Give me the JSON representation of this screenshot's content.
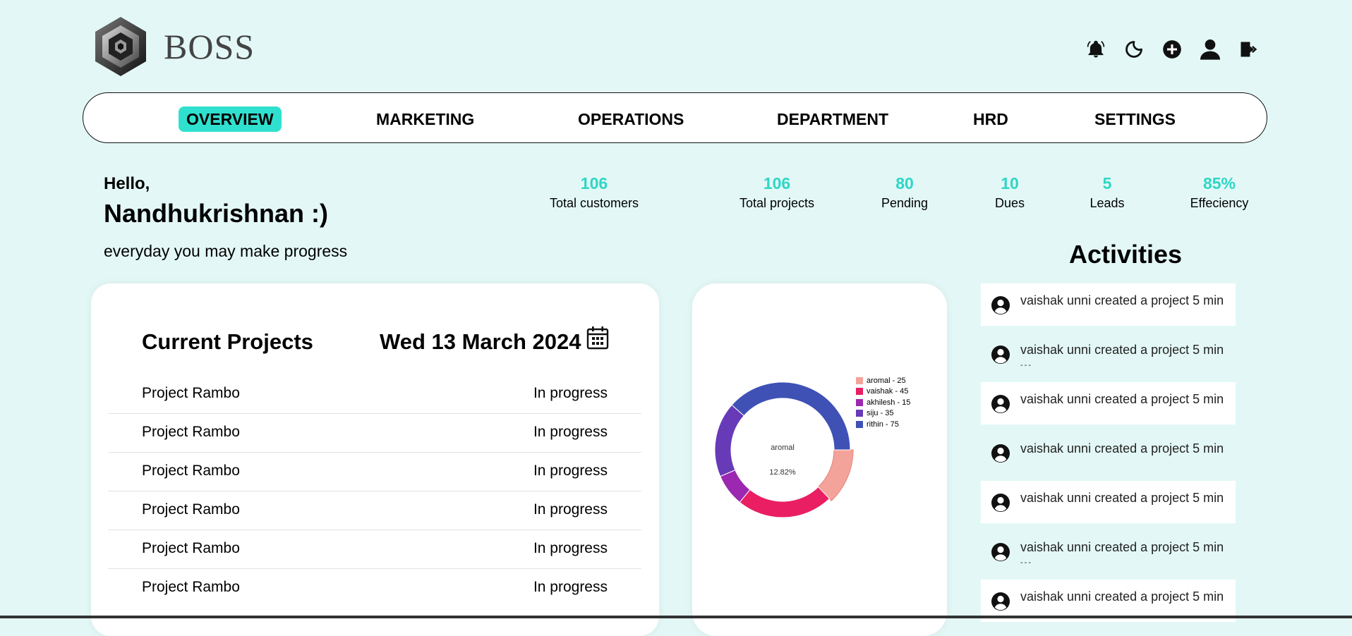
{
  "header": {
    "brand": "BOSS",
    "icons": [
      "bell-icon",
      "moon-icon",
      "plus-circle-icon",
      "user-icon",
      "logout-icon"
    ]
  },
  "nav": {
    "tabs": [
      {
        "label": "OVERVIEW",
        "active": true
      },
      {
        "label": "MARKETING",
        "active": false
      },
      {
        "label": "OPERATIONS",
        "active": false
      },
      {
        "label": "DEPARTMENT",
        "active": false
      },
      {
        "label": "HRD",
        "active": false
      },
      {
        "label": "SETTINGS",
        "active": false
      }
    ]
  },
  "greeting": {
    "hello": "Hello,",
    "name": "Nandhukrishnan :)",
    "tagline": "everyday you may make progress"
  },
  "stats": [
    {
      "value": "106",
      "label": "Total customers"
    },
    {
      "value": "106",
      "label": "Total projects"
    },
    {
      "value": "80",
      "label": "Pending"
    },
    {
      "value": "10",
      "label": "Dues"
    },
    {
      "value": "5",
      "label": "Leads"
    },
    {
      "value": "85%",
      "label": "Effeciency"
    }
  ],
  "projects": {
    "title": "Current Projects",
    "date": "Wed 13 March 2024",
    "rows": [
      {
        "name": "Project Rambo",
        "status": "In progress"
      },
      {
        "name": "Project Rambo",
        "status": "In progress"
      },
      {
        "name": "Project Rambo",
        "status": "In progress"
      },
      {
        "name": "Project Rambo",
        "status": "In progress"
      },
      {
        "name": "Project Rambo",
        "status": "In progress"
      },
      {
        "name": "Project Rambo",
        "status": "In progress"
      }
    ]
  },
  "chart_data": {
    "type": "pie",
    "variant": "donut",
    "legend_position": "top-right",
    "center_label": "aromal",
    "center_value": "12.82%",
    "labels": [
      "aromal - 25",
      "vaishak - 45",
      "akhilesh - 15",
      "siju - 35",
      "rithin - 75"
    ],
    "values": [
      25,
      45,
      15,
      35,
      75
    ],
    "colors": [
      "#f4a39b",
      "#e91e63",
      "#9c27b0",
      "#673ab7",
      "#3f51b5"
    ]
  },
  "activities": {
    "title": "Activities",
    "items": [
      {
        "text": "vaishak unni created a project 5 min",
        "more": "",
        "highlight": true
      },
      {
        "text": "vaishak unni created a project 5 min",
        "more": "---",
        "highlight": false
      },
      {
        "text": "vaishak unni created a project 5 min",
        "more": "",
        "highlight": true
      },
      {
        "text": "vaishak unni created a project 5 min",
        "more": "",
        "highlight": false
      },
      {
        "text": "vaishak unni created a project 5 min",
        "more": "",
        "highlight": true
      },
      {
        "text": "vaishak unni created a project 5 min",
        "more": "---",
        "highlight": false
      },
      {
        "text": "vaishak unni created a project 5 min",
        "more": "",
        "highlight": true
      }
    ]
  }
}
